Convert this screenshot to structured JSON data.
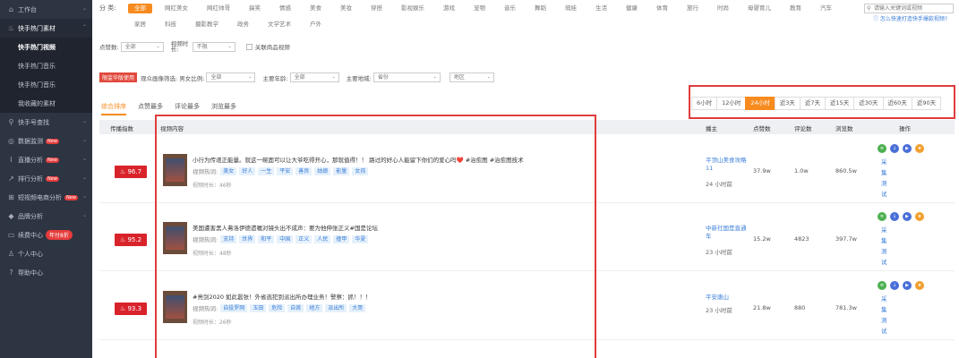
{
  "sidebar": {
    "items": [
      {
        "label": "工作台",
        "icon": "home-icon",
        "type": "top"
      },
      {
        "label": "快手热门素材",
        "icon": "fire-icon",
        "type": "parent"
      },
      {
        "label": "快手热门视频",
        "type": "sub-active"
      },
      {
        "label": "快手热门音乐",
        "type": "sub"
      },
      {
        "label": "快手热门音乐",
        "type": "sub"
      },
      {
        "label": "我收藏的素材",
        "type": "sub"
      },
      {
        "label": "快手号查找",
        "icon": "search-icon",
        "type": "top"
      },
      {
        "label": "数据监测",
        "icon": "monitor-icon",
        "type": "top",
        "badge": "New"
      },
      {
        "label": "直播分析",
        "icon": "chart-icon",
        "type": "top",
        "badge": "New"
      },
      {
        "label": "排行分析",
        "icon": "trend-icon",
        "type": "top",
        "badge": "New"
      },
      {
        "label": "短视频电商分析",
        "icon": "cart-icon",
        "type": "top",
        "badge": "New"
      },
      {
        "label": "品牌分析",
        "icon": "diamond-icon",
        "type": "top"
      },
      {
        "label": "续费中心",
        "icon": "card-icon",
        "type": "plain",
        "badge2": "年付8折"
      },
      {
        "label": "个人中心",
        "icon": "user-icon",
        "type": "plain"
      },
      {
        "label": "帮助中心",
        "icon": "help-icon",
        "type": "plain"
      }
    ]
  },
  "filters": {
    "cat_label": "分  类:",
    "categories": [
      "全部",
      "网红美女",
      "网红帅哥",
      "搞笑",
      "情感",
      "美食",
      "美妆",
      "穿搭",
      "影视娱乐",
      "游戏",
      "宠物",
      "音乐",
      "舞蹈",
      "萌娃",
      "生活",
      "健康",
      "体育",
      "旅行",
      "时尚",
      "母婴育儿",
      "教育",
      "汽车",
      "家居",
      "科技",
      "摄影教学",
      "政务",
      "文学艺术",
      "户外"
    ],
    "search_placeholder": "请输入关键词或视频",
    "help_link": "怎么快速打造快手爆款视频?",
    "likes_label": "点赞数:",
    "likes_value": "全部",
    "duration_label": "视频时长:",
    "duration_value": "不限",
    "related_goods": "关联商品视频",
    "pro_badge": "限监华版使用",
    "audience_label": "观众画像筛选: 男女比例:",
    "gender_value": "全部",
    "age_label": "主要年龄:",
    "age_value": "全部",
    "region_label": "主要地域:",
    "province_value": "省份",
    "city_value": "地区"
  },
  "tabs": [
    "综合排序",
    "点赞最多",
    "评论最多",
    "浏览最多"
  ],
  "time_ranges": [
    "6小时",
    "12小时",
    "24小时",
    "近3天",
    "近7天",
    "近15天",
    "近30天",
    "近60天",
    "近90天"
  ],
  "table": {
    "headers": {
      "index": "传播指数",
      "content": "视频内容",
      "author": "播主",
      "likes": "点赞数",
      "comments": "评论数",
      "views": "浏览数",
      "ops": "操作"
    },
    "hot_label": "视频热词:",
    "rows": [
      {
        "score": "96.7",
        "title": "小行为传递正能量。就这一碗面可以让大爷吃得开心，那就值得！！ 路过的好心人能留下你们的爱心吗❤️ #治愈图 #治愈图技术",
        "tags": [
          "美女",
          "好人",
          "一生",
          "平安",
          "善良",
          "姑娘",
          "能量",
          "女孩"
        ],
        "duration": "视频时长：46秒",
        "author": "平顶山美食攻略11",
        "time": "24 小时前",
        "likes": "37.9w",
        "comments": "1.0w",
        "views": "860.5w"
      },
      {
        "score": "95.2",
        "title": "美国遭害黑人弗洛伊德遗嘱对镜头出不成声：要为他伸张正义#国是论坛",
        "tags": [
          "支持",
          "世界",
          "和平",
          "中国",
          "正义",
          "人民",
          "撞甲",
          "华夏"
        ],
        "duration": "视频时长：48秒",
        "author": "中新社国是直通车",
        "time": "23 小时前",
        "likes": "15.2w",
        "comments": "4823",
        "views": "397.7w"
      },
      {
        "score": "93.3",
        "title": "#亮剑2020 如此嚣张！外省逃犯到派出所办理业务！警察：抓！！！",
        "tags": [
          "自投罗网",
          "玉田",
          "危险",
          "自首",
          "地方",
          "派出所",
          "大哥"
        ],
        "duration": "视频时长：26秒",
        "author": "平安唐山",
        "time": "23 小时前",
        "likes": "21.8w",
        "comments": "880",
        "views": "781.3w"
      }
    ],
    "collect_label": "采集测试"
  }
}
